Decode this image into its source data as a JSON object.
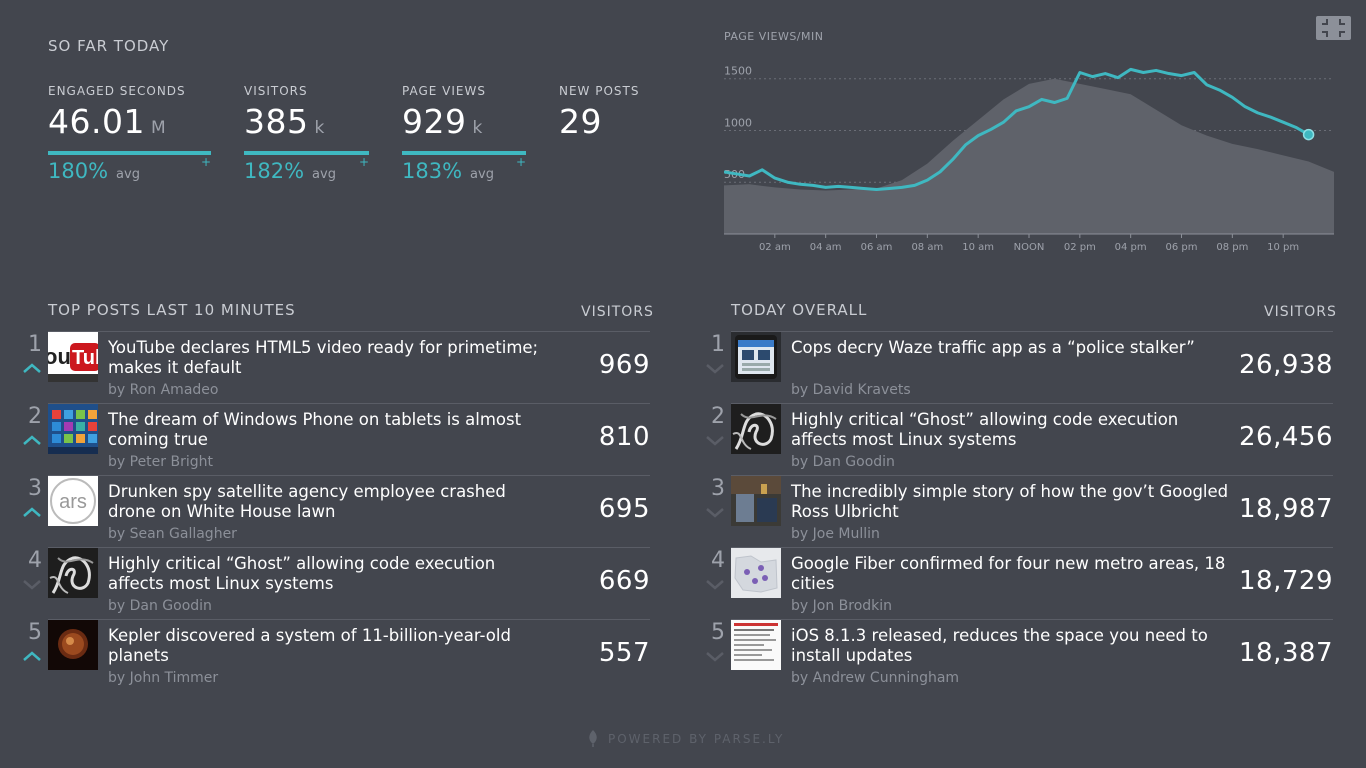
{
  "so_far": {
    "title": "SO FAR TODAY",
    "stats": [
      {
        "label": "ENGAGED SECONDS",
        "value": "46.01",
        "unit": "M",
        "pct": "180%",
        "avg": "avg",
        "plus": "+",
        "bar_fraction": 1.0
      },
      {
        "label": "VISITORS",
        "value": "385",
        "unit": "k",
        "pct": "182%",
        "avg": "avg",
        "plus": "+",
        "bar_fraction": 1.0
      },
      {
        "label": "PAGE VIEWS",
        "value": "929",
        "unit": "k",
        "pct": "183%",
        "avg": "avg",
        "plus": "+",
        "bar_fraction": 1.0
      },
      {
        "label": "NEW POSTS",
        "value": "29"
      }
    ]
  },
  "chart_data": {
    "type": "area",
    "title": "PAGE VIEWS/MIN",
    "x_tick_labels": [
      "02 am",
      "04 am",
      "06 am",
      "08 am",
      "10 am",
      "NOON",
      "02 pm",
      "04 pm",
      "06 pm",
      "08 pm",
      "10 pm"
    ],
    "y_tick_labels": [
      "500",
      "1000",
      "1500"
    ],
    "ylim": [
      0,
      1700
    ],
    "xlim": [
      0,
      24
    ],
    "grid": true,
    "series": [
      {
        "kind": "area",
        "x": [
          0,
          1,
          2,
          3,
          4,
          5,
          6,
          7,
          8,
          9,
          10,
          11,
          12,
          13,
          14,
          15,
          16,
          17,
          18,
          19,
          20,
          21,
          22,
          23,
          24
        ],
        "y": [
          470,
          480,
          450,
          430,
          420,
          430,
          440,
          520,
          680,
          900,
          1100,
          1300,
          1450,
          1500,
          1450,
          1400,
          1350,
          1200,
          1050,
          950,
          870,
          820,
          760,
          700,
          600
        ]
      },
      {
        "kind": "line",
        "x": [
          0,
          0.5,
          1,
          1.5,
          2,
          2.5,
          3,
          3.5,
          4,
          4.5,
          5,
          5.5,
          6,
          6.5,
          7,
          7.5,
          8,
          8.5,
          9,
          9.5,
          10,
          10.5,
          11,
          11.5,
          12,
          12.5,
          13,
          13.5,
          14,
          14.5,
          15,
          15.5,
          16,
          16.5,
          17,
          17.5,
          18,
          18.5,
          19,
          19.5,
          20,
          20.5,
          21,
          21.5,
          22,
          22.5,
          23
        ],
        "y": [
          600,
          580,
          560,
          620,
          540,
          500,
          480,
          470,
          450,
          460,
          450,
          440,
          430,
          440,
          450,
          470,
          520,
          600,
          720,
          860,
          950,
          1010,
          1080,
          1190,
          1230,
          1300,
          1270,
          1310,
          1560,
          1520,
          1550,
          1510,
          1590,
          1560,
          1580,
          1550,
          1530,
          1560,
          1440,
          1390,
          1320,
          1230,
          1170,
          1130,
          1080,
          1030,
          960
        ]
      }
    ]
  },
  "top_posts": {
    "title": "TOP POSTS LAST 10 MINUTES",
    "visitors_label": "VISITORS",
    "items": [
      {
        "rank": "1",
        "trend": "up",
        "title": "YouTube declares HTML5 video ready for primetime; makes it default",
        "author": "by Ron Amadeo",
        "count": "969",
        "thumb": "youtube-logo"
      },
      {
        "rank": "2",
        "trend": "up",
        "title": "The dream of Windows Phone on tablets is almost coming true",
        "author": "by Peter Bright",
        "count": "810",
        "thumb": "windows-tiles"
      },
      {
        "rank": "3",
        "trend": "up",
        "title": "Drunken spy satellite agency employee crashed drone on White House lawn",
        "author": "by Sean Gallagher",
        "count": "695",
        "thumb": "ars-logo"
      },
      {
        "rank": "4",
        "trend": "down",
        "title": "Highly critical “Ghost” allowing code execution affects most Linux systems",
        "author": "by Dan Goodin",
        "count": "669",
        "thumb": "ghost-smoke"
      },
      {
        "rank": "5",
        "trend": "up",
        "title": "Kepler discovered a system of 11-billion-year-old planets",
        "author": "by John Timmer",
        "count": "557",
        "thumb": "planet-star"
      }
    ]
  },
  "today_overall": {
    "title": "TODAY OVERALL",
    "visitors_label": "VISITORS",
    "items": [
      {
        "rank": "1",
        "trend": "down",
        "title": "Cops decry Waze traffic app as a “police stalker”",
        "author": "by David Kravets",
        "count": "26,938",
        "thumb": "phone-app"
      },
      {
        "rank": "2",
        "trend": "down",
        "title": "Highly critical “Ghost” allowing code execution affects most Linux systems",
        "author": "by Dan Goodin",
        "count": "26,456",
        "thumb": "ghost-smoke"
      },
      {
        "rank": "3",
        "trend": "down",
        "title": "The incredibly simple story of how the gov’t Googled Ross Ulbricht",
        "author": "by Joe Mullin",
        "count": "18,987",
        "thumb": "photo-scene"
      },
      {
        "rank": "4",
        "trend": "down",
        "title": "Google Fiber confirmed for four new metro areas, 18 cities",
        "author": "by Jon Brodkin",
        "count": "18,729",
        "thumb": "map-pins"
      },
      {
        "rank": "5",
        "trend": "down",
        "title": "iOS 8.1.3 released, reduces the space you need to install updates",
        "author": "by Andrew Cunningham",
        "count": "18,387",
        "thumb": "web-page"
      }
    ]
  },
  "footer": {
    "text": "POWERED BY PARSE.LY",
    "icon": "parsely-leaf-icon"
  },
  "colors": {
    "accent": "#3fb8c1",
    "background": "#43464e",
    "area": "#5f626a"
  }
}
